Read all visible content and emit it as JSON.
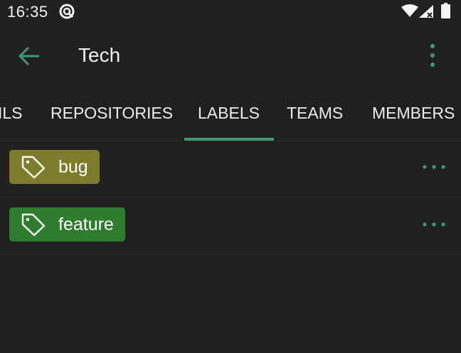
{
  "status_bar": {
    "time": "16:35"
  },
  "app_bar": {
    "title": "Tech"
  },
  "tabs": [
    {
      "label": "ILS"
    },
    {
      "label": "REPOSITORIES"
    },
    {
      "label": "LABELS"
    },
    {
      "label": "TEAMS"
    },
    {
      "label": "MEMBERS"
    }
  ],
  "active_tab": "LABELS",
  "labels": [
    {
      "name": "bug",
      "color": "#7d7c2a"
    },
    {
      "name": "feature",
      "color": "#2e7d2e"
    }
  ],
  "colors": {
    "accent": "#3d9b74",
    "background": "#202020"
  },
  "icons": {
    "back": "arrow-left-icon",
    "overflow": "more-vertical-icon",
    "label": "tag-icon",
    "row_menu": "more-horizontal-icon"
  }
}
